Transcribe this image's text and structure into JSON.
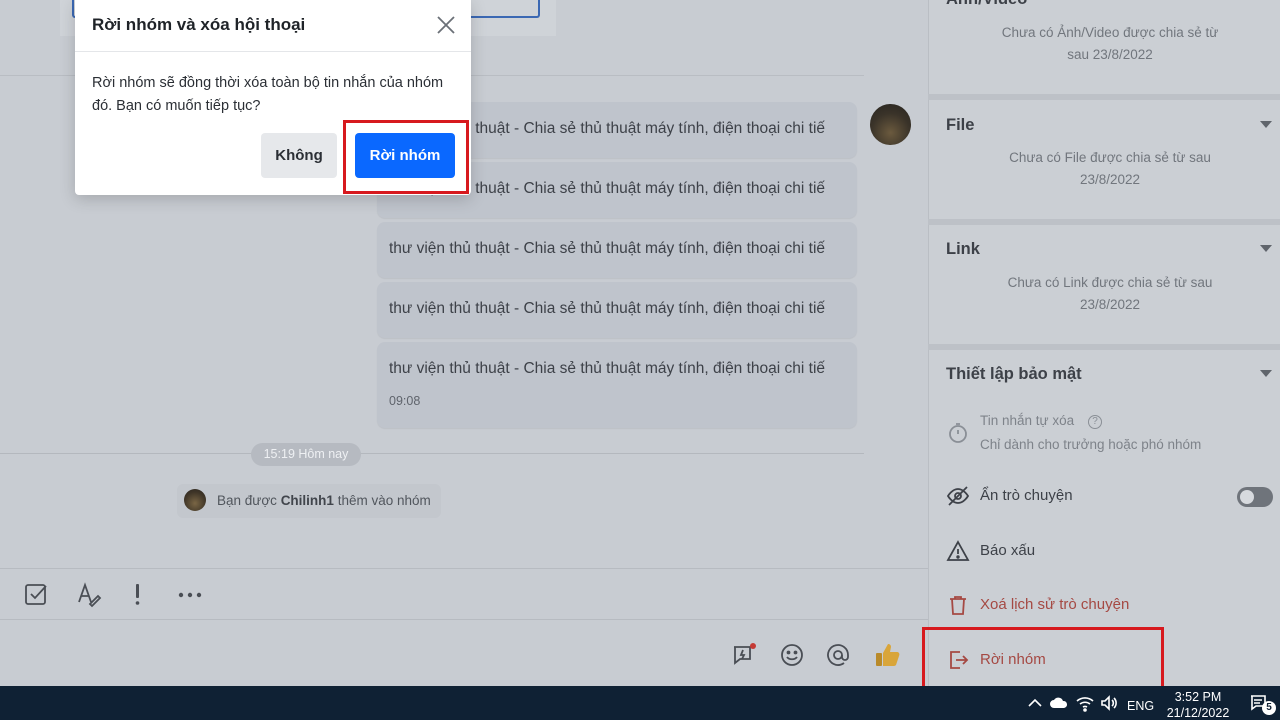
{
  "dialog": {
    "title": "Rời nhóm và xóa hội thoại",
    "body": "Rời nhóm sẽ đồng thời xóa toàn bộ tin nhắn của nhóm đó. Bạn có muốn tiếp tục?",
    "cancel_label": "Không",
    "confirm_label": "Rời nhóm"
  },
  "messages": [
    {
      "text": "thư viện thủ thuật - Chia sẻ thủ thuật máy tính, điện thoại chi tiế"
    },
    {
      "text": "thư viện thủ thuật - Chia sẻ thủ thuật máy tính, điện thoại chi tiế"
    },
    {
      "text": "thư viện thủ thuật - Chia sẻ thủ thuật máy tính, điện thoại chi tiế"
    },
    {
      "text": "thư viện thủ thuật - Chia sẻ thủ thuật máy tính, điện thoại chi tiế"
    },
    {
      "text": "thư viện thủ thuật - Chia sẻ thủ thuật máy tính, điện thoại chi tiế",
      "time": "09:08"
    }
  ],
  "chat": {
    "time_divider": "15:19 Hôm nay",
    "system_prefix": "Bạn được",
    "system_user": "Chilinh1",
    "system_suffix": "thêm vào nhóm"
  },
  "right_panel": {
    "media_title": "Ảnh/Video",
    "media_empty": "Chưa có Ảnh/Video được chia sẻ từ sau 23/8/2022",
    "file_title": "File",
    "file_empty": "Chưa có File được chia sẻ từ sau 23/8/2022",
    "link_title": "Link",
    "link_empty": "Chưa có Link được chia sẻ từ sau 23/8/2022",
    "security_title": "Thiết lập bảo mật",
    "self_delete": "Tin nhắn tự xóa",
    "self_delete_note": "Chỉ dành cho trưởng hoặc phó nhóm",
    "hide_chat": "Ẩn trò chuyện",
    "report": "Báo xấu",
    "delete_history": "Xoá lịch sử trò chuyện",
    "leave_group": "Rời nhóm"
  },
  "icons": {
    "toolbar": [
      "checklist-icon",
      "text-format-icon",
      "important-icon",
      "more-icon"
    ],
    "input": [
      "quick-message-icon",
      "emoji-icon",
      "mention-icon",
      "thumbs-up-icon"
    ]
  },
  "taskbar": {
    "language": "ENG",
    "time": "3:52 PM",
    "date": "21/12/2022",
    "notification_count": "5"
  },
  "colors": {
    "primary_button": "#0a68ff",
    "danger_text": "#a54943",
    "highlight": "#d7191e"
  }
}
